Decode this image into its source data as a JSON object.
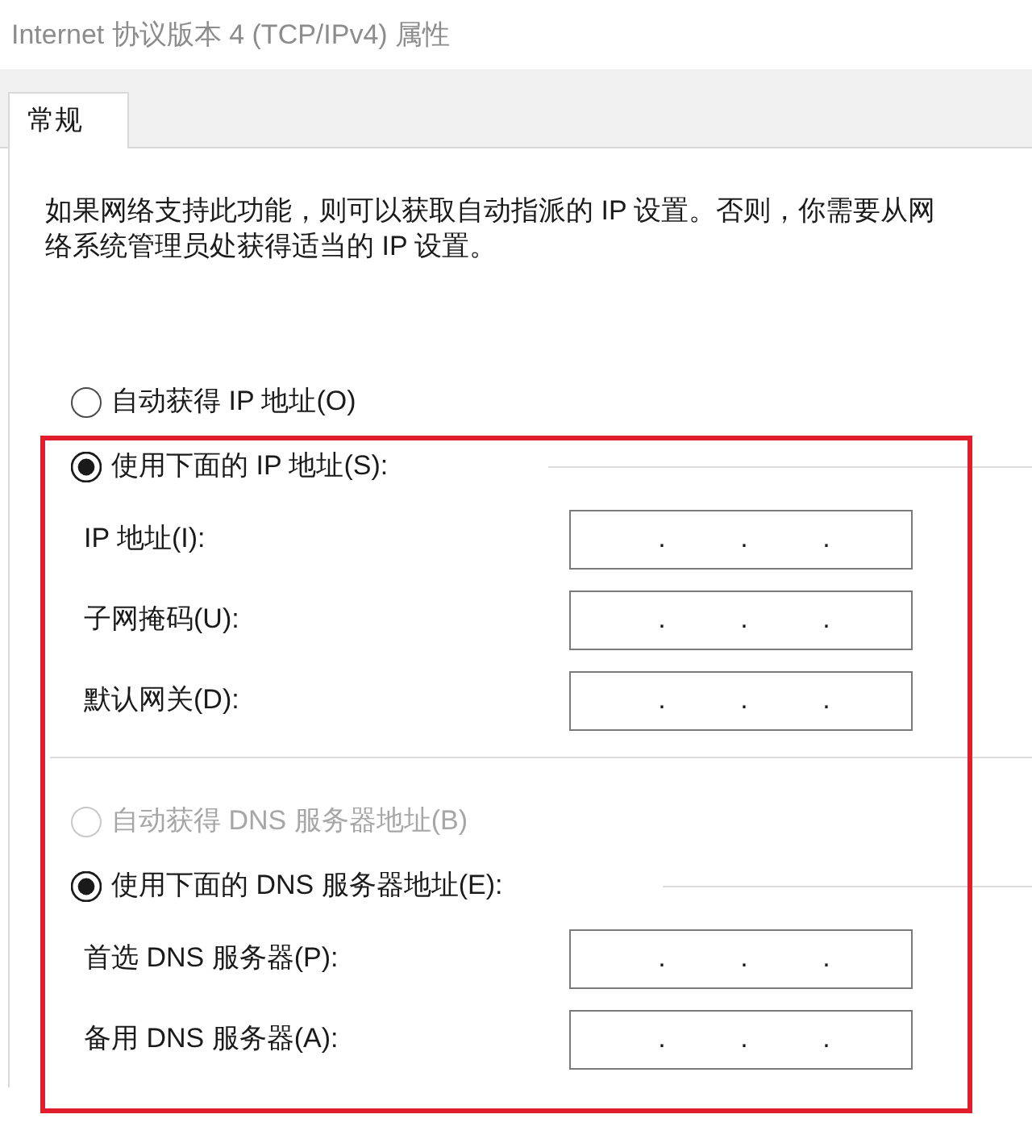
{
  "window": {
    "title": "Internet 协议版本 4 (TCP/IPv4) 属性"
  },
  "tabs": [
    {
      "label": "常规",
      "selected": true
    }
  ],
  "description": "如果网络支持此功能，则可以获取自动指派的 IP 设置。否则，你需要从网络系统管理员处获得适当的 IP 设置。",
  "ip_options": [
    {
      "label": "自动获得 IP 地址(O)",
      "selected": false,
      "disabled": false
    },
    {
      "label": "使用下面的 IP 地址(S):",
      "selected": true,
      "disabled": false
    }
  ],
  "ip_fields": [
    {
      "label": "IP 地址(I):",
      "separators": [
        ".",
        ".",
        "."
      ]
    },
    {
      "label": "子网掩码(U):",
      "separators": [
        ".",
        ".",
        "."
      ]
    },
    {
      "label": "默认网关(D):",
      "separators": [
        ".",
        ".",
        "."
      ]
    }
  ],
  "dns_options": [
    {
      "label": "自动获得 DNS 服务器地址(B)",
      "selected": false,
      "disabled": true
    },
    {
      "label": "使用下面的 DNS 服务器地址(E):",
      "selected": true,
      "disabled": false
    }
  ],
  "dns_fields": [
    {
      "label": "首选 DNS 服务器(P):",
      "separators": [
        ".",
        ".",
        "."
      ]
    },
    {
      "label": "备用 DNS 服务器(A):",
      "separators": [
        ".",
        ".",
        "."
      ]
    }
  ]
}
